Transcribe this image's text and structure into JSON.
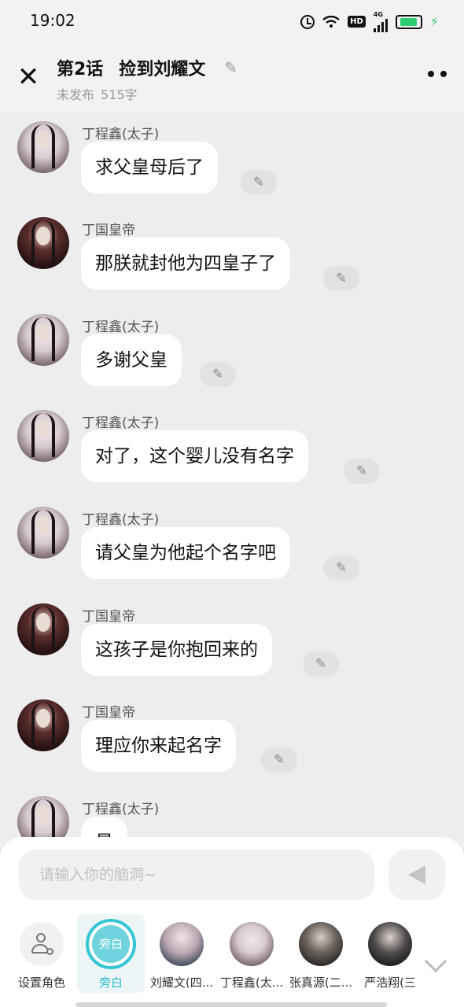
{
  "status": {
    "time": "19:02",
    "network": "4G",
    "hd": "HD",
    "battery_level": 0.8
  },
  "header": {
    "episode_num": "第2话",
    "episode_title": "捡到刘耀文",
    "status_text": "未发布",
    "word_count": "515字"
  },
  "messages": [
    {
      "sender": "丁程鑫(太子)",
      "text": "求父皇母后了",
      "avatar": "prince"
    },
    {
      "sender": "丁国皇帝",
      "text": "那朕就封他为四皇子了",
      "avatar": "emperor"
    },
    {
      "sender": "丁程鑫(太子)",
      "text": "多谢父皇",
      "avatar": "prince"
    },
    {
      "sender": "丁程鑫(太子)",
      "text": "对了，这个婴儿没有名字",
      "avatar": "prince"
    },
    {
      "sender": "丁程鑫(太子)",
      "text": "请父皇为他起个名字吧",
      "avatar": "prince"
    },
    {
      "sender": "丁国皇帝",
      "text": "这孩子是你抱回来的",
      "avatar": "emperor"
    },
    {
      "sender": "丁国皇帝",
      "text": "理应你来起名字",
      "avatar": "emperor"
    },
    {
      "sender": "丁程鑫(太子)",
      "text": "最",
      "avatar": "prince"
    }
  ],
  "composer": {
    "placeholder": "请输入你的脑洞~"
  },
  "roles": [
    {
      "label": "设置角色",
      "type": "setting"
    },
    {
      "label": "旁白",
      "type": "narrator",
      "avatar_text": "旁白",
      "active": true
    },
    {
      "label": "刘耀文(四...",
      "type": "person"
    },
    {
      "label": "丁程鑫(太...",
      "type": "person"
    },
    {
      "label": "张真源(二...",
      "type": "person"
    },
    {
      "label": "严浩翔(三",
      "type": "person"
    }
  ],
  "colors": {
    "accent": "#35c6d6",
    "bubble": "#ffffff",
    "background": "#ededed"
  }
}
